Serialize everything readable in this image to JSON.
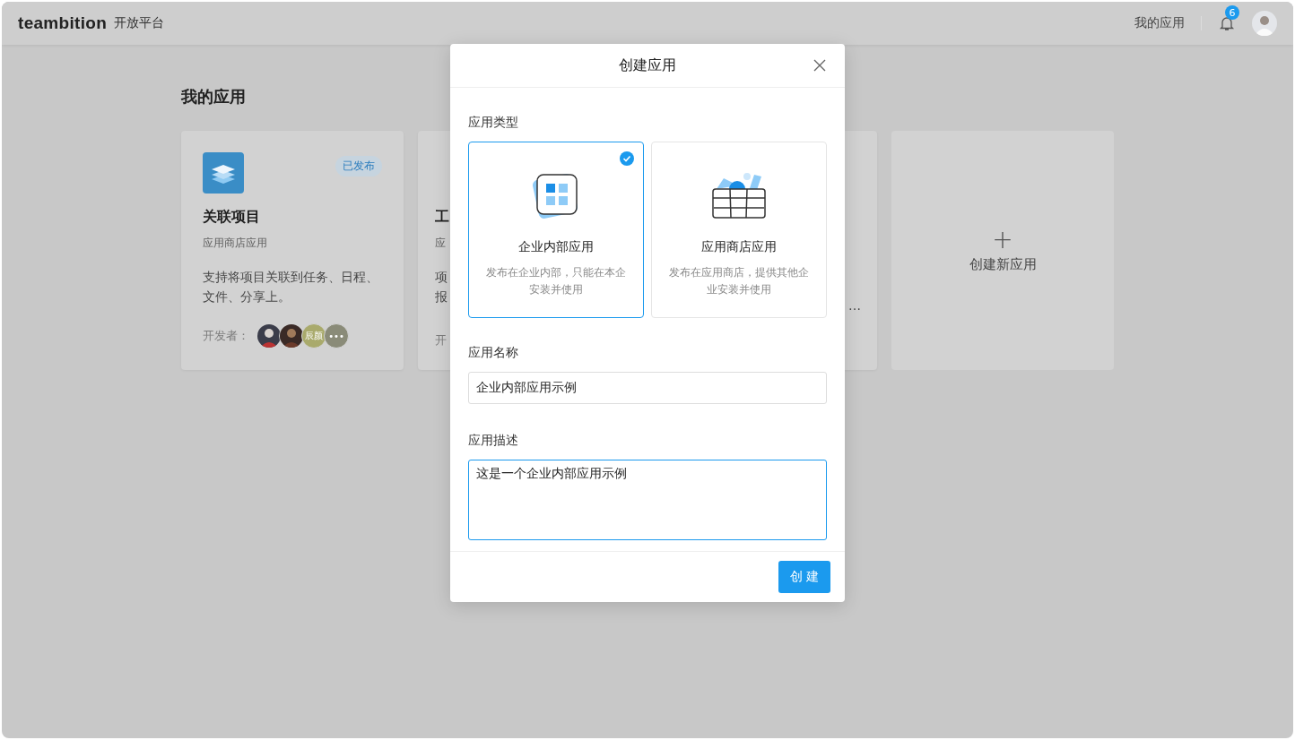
{
  "header": {
    "logo": "teambition",
    "product": "开放平台",
    "nav_link": "我的应用",
    "notification_badge": "6"
  },
  "page": {
    "title": "我的应用",
    "apps": [
      {
        "kind": "full",
        "title": "关联项目",
        "subtitle": "应用商店应用",
        "status": "已发布",
        "description": "支持将项目关联到任务、日程、文件、分享上。",
        "developer_label": "开发者：",
        "developers": [
          {
            "kind": "picture"
          },
          {
            "kind": "picture"
          },
          {
            "kind": "initials",
            "text": "辰颜",
            "color": "#a9aa6c"
          },
          {
            "kind": "more",
            "text": "•••",
            "color": "#8a8b78"
          }
        ]
      },
      {
        "kind": "clipped_left",
        "title": "工",
        "subtitle": "应",
        "description_lines": [
          "项",
          "报"
        ],
        "developer_label": "开"
      },
      {
        "kind": "clipped_right",
        "description_tail": "…"
      }
    ],
    "create_card": {
      "icon": "+",
      "label": "创建新应用"
    }
  },
  "dialog": {
    "title": "创建应用",
    "type_label": "应用类型",
    "types": [
      {
        "kind": "internal",
        "title": "企业内部应用",
        "description": "发布在企业内部，只能在本企安装并使用",
        "selected": true
      },
      {
        "kind": "store",
        "title": "应用商店应用",
        "description": "发布在应用商店，提供其他企业安装并使用",
        "selected": false
      }
    ],
    "name_label": "应用名称",
    "name_value": "企业内部应用示例",
    "description_label": "应用描述",
    "description_value": "这是一个企业内部应用示例",
    "submit": "创 建"
  }
}
